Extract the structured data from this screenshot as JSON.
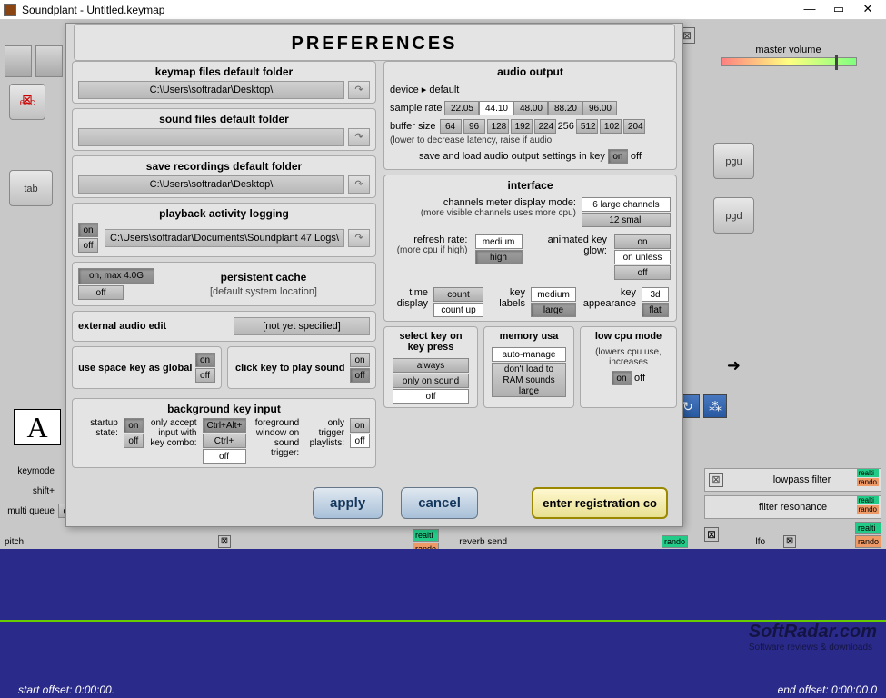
{
  "window": {
    "title": "Soundplant - Untitled.keymap"
  },
  "master_volume": "master volume",
  "keys": {
    "esc": "esc",
    "tab": "tab",
    "pgu": "pgu",
    "pgd": "pgd"
  },
  "dialog": {
    "title": "PREFERENCES",
    "keymap_folder": {
      "title": "keymap files default folder",
      "path": "C:\\Users\\softradar\\Desktop\\"
    },
    "sound_folder": {
      "title": "sound files default folder"
    },
    "recordings_folder": {
      "title": "save recordings default folder",
      "path": "C:\\Users\\softradar\\Desktop\\"
    },
    "activity": {
      "title": "playback activity logging",
      "path": "C:\\Users\\softradar\\Documents\\Soundplant 47 Logs\\",
      "on": "on",
      "off": "off"
    },
    "cache": {
      "title": "persistent cache",
      "on": "on, max 4.0G",
      "off": "off",
      "loc": "[default system location]"
    },
    "extedit": {
      "title": "external audio edit",
      "value": "[not yet specified]"
    },
    "space": {
      "title": "use space key as global",
      "on": "on",
      "off": "off"
    },
    "click": {
      "title": "click key to play sound",
      "on": "on",
      "off": "off"
    },
    "bgkey": {
      "title": "background key input",
      "startup": "startup state:",
      "only_accept": "only accept input with key combo:",
      "foreground": "foreground window on sound trigger:",
      "only_trigger": "only trigger playlists:",
      "ctrl_alt": "Ctrl+Alt+",
      "ctrl": "Ctrl+",
      "on": "on",
      "off": "off"
    },
    "audio": {
      "title": "audio output",
      "device": "device",
      "device_val": "default",
      "samplerate": "sample rate",
      "rates": [
        "22.05",
        "44.10",
        "48.00",
        "88.20",
        "96.00"
      ],
      "rate_selected": "44.10",
      "buffer": "buffer size",
      "buffers": [
        "64",
        "96",
        "128",
        "192",
        "224",
        "256",
        "512",
        "102",
        "204"
      ],
      "buffer_selected": "256",
      "note": "(lower to decrease latency, raise if audio",
      "save_load": "save and load audio output settings in key",
      "on": "on",
      "off": "off"
    },
    "interface": {
      "title": "interface",
      "meter": "channels meter display mode:",
      "meter_note": "(more visible channels uses more cpu)",
      "meter_opts": [
        "6 large channels",
        "12 small"
      ],
      "refresh": "refresh rate:",
      "refresh_note": "(more cpu if high)",
      "refresh_opts": [
        "medium",
        "high"
      ],
      "glow": "animated key glow:",
      "glow_opts": [
        "on",
        "on unless",
        "off"
      ],
      "time_display": "time display",
      "time_opts": [
        "count",
        "count up"
      ],
      "key_labels": "key labels",
      "key_labels_opts": [
        "medium",
        "large"
      ],
      "key_appearance": "key appearance",
      "key_app_opts": [
        "3d",
        "flat"
      ]
    },
    "selectkey": {
      "title": "select key on key press",
      "opts": [
        "always",
        "only on sound",
        "off"
      ]
    },
    "memory": {
      "title": "memory usa",
      "auto": "auto-manage",
      "dontload": "don't load to RAM sounds large"
    },
    "lowcpu": {
      "title": "low cpu mode",
      "note": "(lowers cpu use, increases",
      "on": "on",
      "off": "off"
    },
    "apply": "apply",
    "cancel": "cancel",
    "register": "enter registration co"
  },
  "bottom": {
    "keymode": "keymode",
    "shift": "shift+",
    "multi": "multi queue",
    "off": "off",
    "pitch": "pitch",
    "send": "reverb send",
    "lfo": "lfo",
    "lowpass": "lowpass filter",
    "resonance": "filter resonance",
    "realti": "realti",
    "rando": "rando",
    "start_offset": "start offset: 0:00:00.",
    "end_offset": "end offset: 0:00:00.0",
    "A": "A"
  },
  "watermark": {
    "main": "SoftRadar.com",
    "sub": "Software reviews & downloads"
  }
}
